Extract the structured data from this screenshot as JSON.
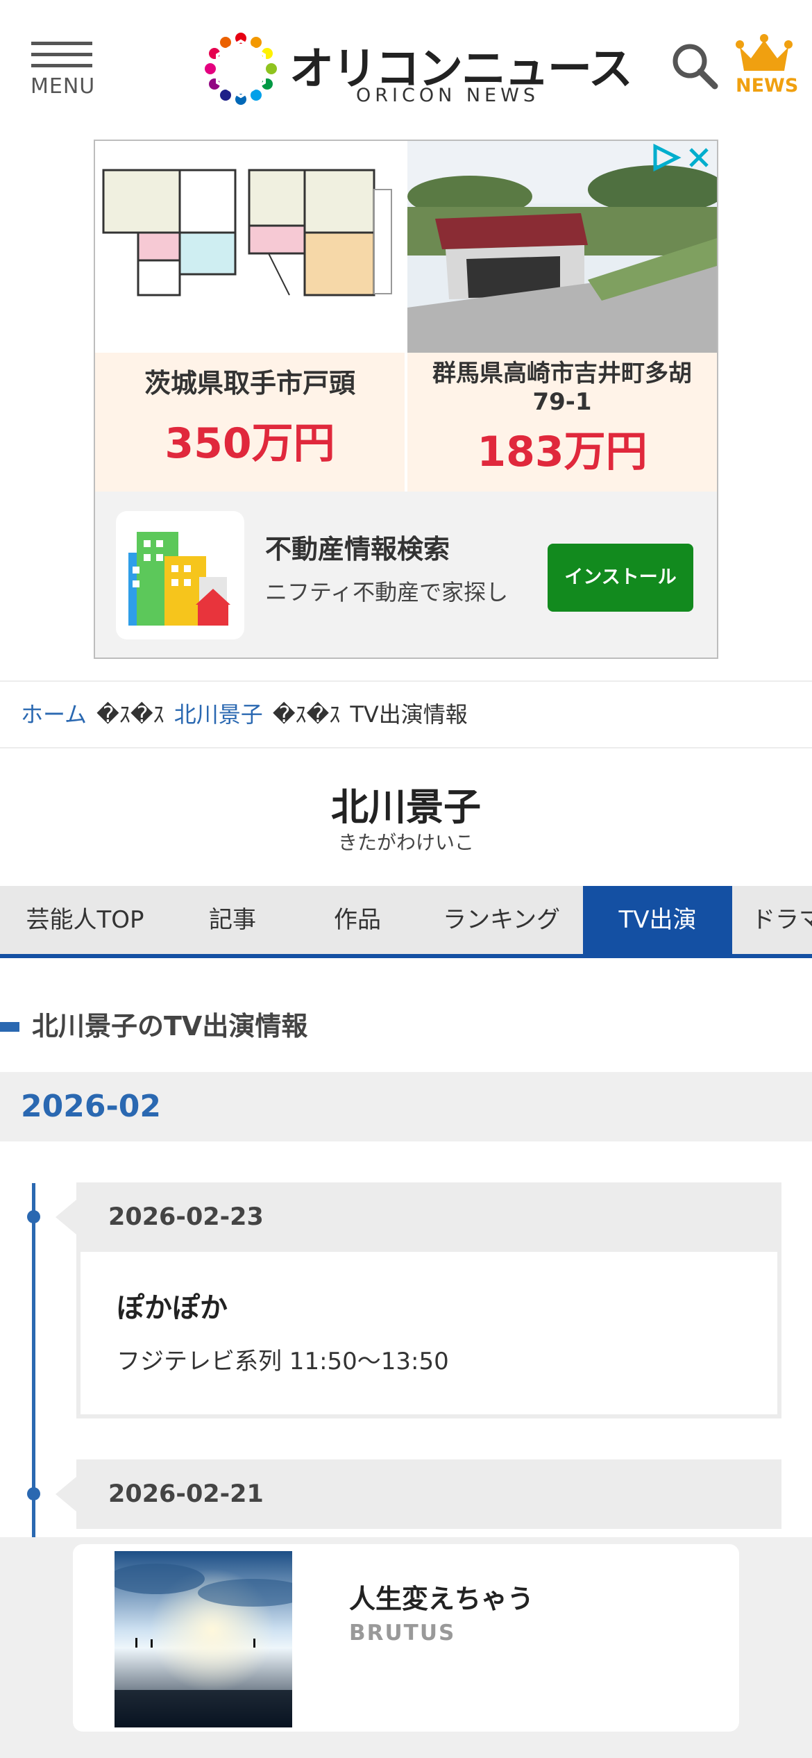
{
  "header": {
    "menu_label": "MENU",
    "logo_jp": "オリコンニュース",
    "logo_en": "ORICON NEWS",
    "news_label": "NEWS"
  },
  "ad": {
    "listings": [
      {
        "location": "茨城県取手市戸頭",
        "price": "350万円"
      },
      {
        "location": "群馬県高崎市吉井町多胡79-1",
        "price": "183万円"
      }
    ],
    "app_title": "不動産情報検索",
    "app_desc": "ニフティ不動産で家探し",
    "install_label": "インストール"
  },
  "breadcrumb": {
    "home": "ホーム",
    "separator": "�ｽ�ｽ",
    "person": "北川景子",
    "current": "TV出演情報"
  },
  "person": {
    "name": "北川景子",
    "kana": "きたがわけいこ"
  },
  "tabs": [
    {
      "label": "芸能人TOP",
      "active": false
    },
    {
      "label": "記事",
      "active": false
    },
    {
      "label": "作品",
      "active": false
    },
    {
      "label": "ランキング",
      "active": false
    },
    {
      "label": "TV出演",
      "active": true
    },
    {
      "label": "ドラマ",
      "active": false
    }
  ],
  "section": {
    "title": "北川景子のTV出演情報",
    "month": "2026-02"
  },
  "entries": [
    {
      "date": "2026-02-23",
      "title": "ぽかぽか",
      "detail": "フジテレビ系列 11:50〜13:50"
    },
    {
      "date": "2026-02-21"
    }
  ],
  "promo": {
    "title": "人生変えちゃう",
    "source": "BRUTUS"
  },
  "colors": {
    "accent_blue": "#1450a3",
    "link_blue": "#2a68b1",
    "price_red": "#e0283c",
    "install_green": "#128a1e",
    "crown_orange": "#f0a010"
  },
  "icons": [
    "menu-icon",
    "oricon-logo-mark",
    "search-icon",
    "crown-icon",
    "adchoices-icon",
    "close-icon",
    "building-app-icon"
  ]
}
